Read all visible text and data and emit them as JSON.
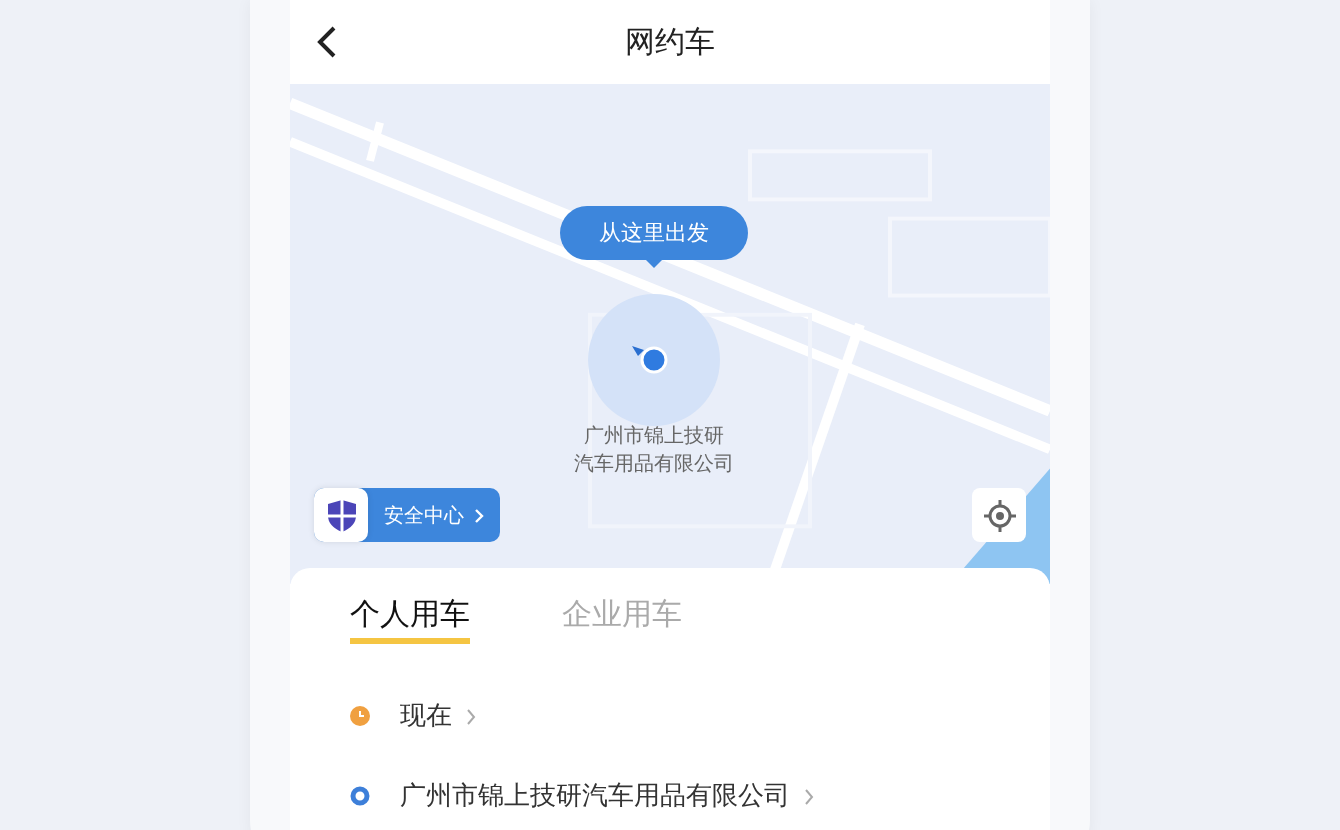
{
  "header": {
    "title": "网约车"
  },
  "map": {
    "start_bubble": "从这里出发",
    "place_label": [
      "广州市锦上技研",
      "汽车用品有限公司"
    ],
    "safety_button": "安全中心"
  },
  "tabs": [
    {
      "label": "个人用车",
      "selected": true
    },
    {
      "label": "企业用车",
      "selected": false
    }
  ],
  "rows": [
    {
      "kind": "time",
      "text": "现在",
      "color": "#f0a040"
    },
    {
      "kind": "origin",
      "text": "广州市锦上技研汽车用品有限公司",
      "color": "#3d7fd9"
    }
  ]
}
